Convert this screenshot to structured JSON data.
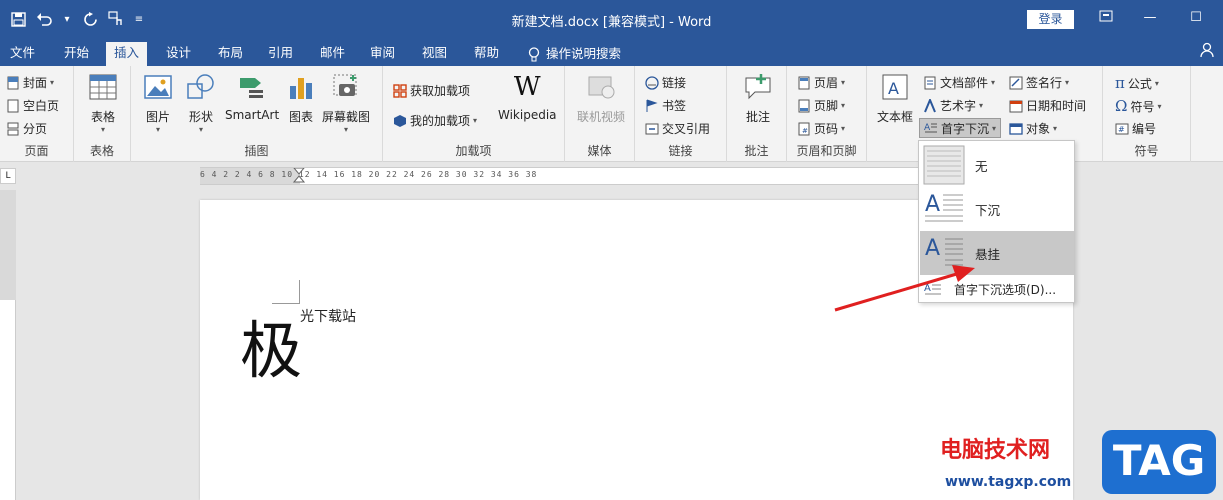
{
  "window": {
    "title": "新建文档.docx [兼容模式] - Word",
    "login_label": "登录"
  },
  "tabs": [
    {
      "label": "文件"
    },
    {
      "label": "开始"
    },
    {
      "label": "插入"
    },
    {
      "label": "设计"
    },
    {
      "label": "布局"
    },
    {
      "label": "引用"
    },
    {
      "label": "邮件"
    },
    {
      "label": "审阅"
    },
    {
      "label": "视图"
    },
    {
      "label": "帮助"
    },
    {
      "label": "操作说明搜索"
    }
  ],
  "ribbon": {
    "pages": {
      "label": "页面",
      "cover": "封面",
      "blank": "空白页",
      "break": "分页"
    },
    "tables": {
      "label": "表格",
      "table": "表格"
    },
    "illustrations": {
      "label": "插图",
      "picture": "图片",
      "shapes": "形状",
      "smartart": "SmartArt",
      "chart": "图表",
      "screenshot": "屏幕截图"
    },
    "addins": {
      "label": "加载项",
      "get": "获取加载项",
      "mine": "我的加载项",
      "wiki": "Wikipedia"
    },
    "media": {
      "label": "媒体",
      "video": "联机视频"
    },
    "links": {
      "label": "链接",
      "link": "链接",
      "bookmark": "书签",
      "crossref": "交叉引用"
    },
    "comments": {
      "label": "批注",
      "comment": "批注"
    },
    "headerfooter": {
      "label": "页眉和页脚",
      "header": "页眉",
      "footer": "页脚",
      "pagenum": "页码"
    },
    "text": {
      "textbox": "文本框",
      "parts": "文档部件",
      "wordart": "艺术字",
      "dropcap": "首字下沉",
      "signature": "签名行",
      "datetime": "日期和时间",
      "object": "对象"
    },
    "symbols": {
      "label": "符号",
      "equation": "公式",
      "symbol": "符号",
      "number": "编号"
    }
  },
  "ruler": {
    "numbers": "6  4  2     2  4  6  8  10  12  14  16  18  20  22  24  26  28  30  32  34  36  38"
  },
  "document": {
    "big_char": "极",
    "small_text": "光下载站"
  },
  "dropcap_menu": {
    "items": [
      {
        "label": "无"
      },
      {
        "label": "下沉"
      },
      {
        "label": "悬挂"
      }
    ],
    "options": "首字下沉选项(D)..."
  },
  "watermark": {
    "text": "电脑技术网",
    "url": "www.tagxp.com",
    "logo": "TAG"
  },
  "colors": {
    "accent": "#2b579a",
    "highlight": "#c8c8c8",
    "arrow": "#e02020"
  }
}
